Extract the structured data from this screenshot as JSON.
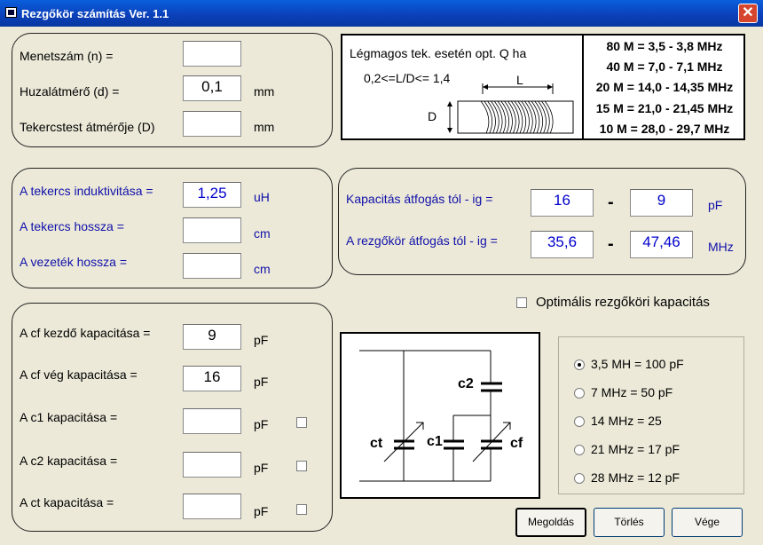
{
  "window": {
    "title": "Rezgőkör számítás Ver. 1.1",
    "close": "✕"
  },
  "geo": {
    "turns_label": "Menetszám  (n)  =",
    "turns_value": "",
    "wire_label": "Huzalátmérő (d) =",
    "wire_value": "0,1",
    "wire_unit": "mm",
    "coil_label": "Tekercstest átmérője (D)",
    "coil_value": "",
    "coil_unit": "mm"
  },
  "info": {
    "line1": "Légmagos tek. esetén opt. Q ha",
    "line2": "0,2<=L/D<= 1,4",
    "L": "L",
    "D": "D",
    "bands": [
      "80 M = 3,5 - 3,8 MHz",
      "40 M = 7,0 - 7,1 MHz",
      "20 M = 14,0 - 14,35 MHz",
      "15 M = 21,0 - 21,45 MHz",
      "10 M = 28,0 - 29,7 MHz"
    ]
  },
  "ind": {
    "ind_label": "A tekercs induktivitása  =",
    "ind_value": "1,25",
    "ind_unit": "uH",
    "len_label": "A tekercs hossza =",
    "len_value": "",
    "len_unit": "cm",
    "wire_label": "A vezeték hossza =",
    "wire_value": "",
    "wire_unit": "cm"
  },
  "range": {
    "cap_label": "Kapacitás átfogás  tól  - ig  =",
    "cap_from": "16",
    "cap_to": "9",
    "cap_unit": "pF",
    "dash": "-",
    "freq_label": "A rezgőkör átfogás tól - ig  =",
    "freq_from": "35,6",
    "freq_to": "47,46",
    "freq_unit": "MHz"
  },
  "optimal_label": "Optimális rezgőköri kapacitás",
  "caps": {
    "cf_start_label": "A cf kezdő kapacitása =",
    "cf_start_value": "9",
    "cf_end_label": "A cf vég kapacitása =",
    "cf_end_value": "16",
    "c1_label": "A c1 kapacitása =",
    "c1_value": "",
    "c2_label": "A c2 kapacitása =",
    "c2_value": "",
    "ct_label": "A ct kapacitása =",
    "ct_value": "",
    "unit": "pF"
  },
  "circuit": {
    "ct": "ct",
    "c1": "c1",
    "c2": "c2",
    "cf": "cf"
  },
  "radios": [
    {
      "label": "3,5 MH  = 100 pF",
      "selected": true
    },
    {
      "label": "7 MHz = 50 pF",
      "selected": false
    },
    {
      "label": "14 MHz = 25",
      "selected": false
    },
    {
      "label": "21 MHz = 17 pF",
      "selected": false
    },
    {
      "label": "28 MHz = 12 pF",
      "selected": false
    }
  ],
  "buttons": {
    "solve": "Megoldás",
    "clear": "Törlés",
    "end": "Vége"
  }
}
